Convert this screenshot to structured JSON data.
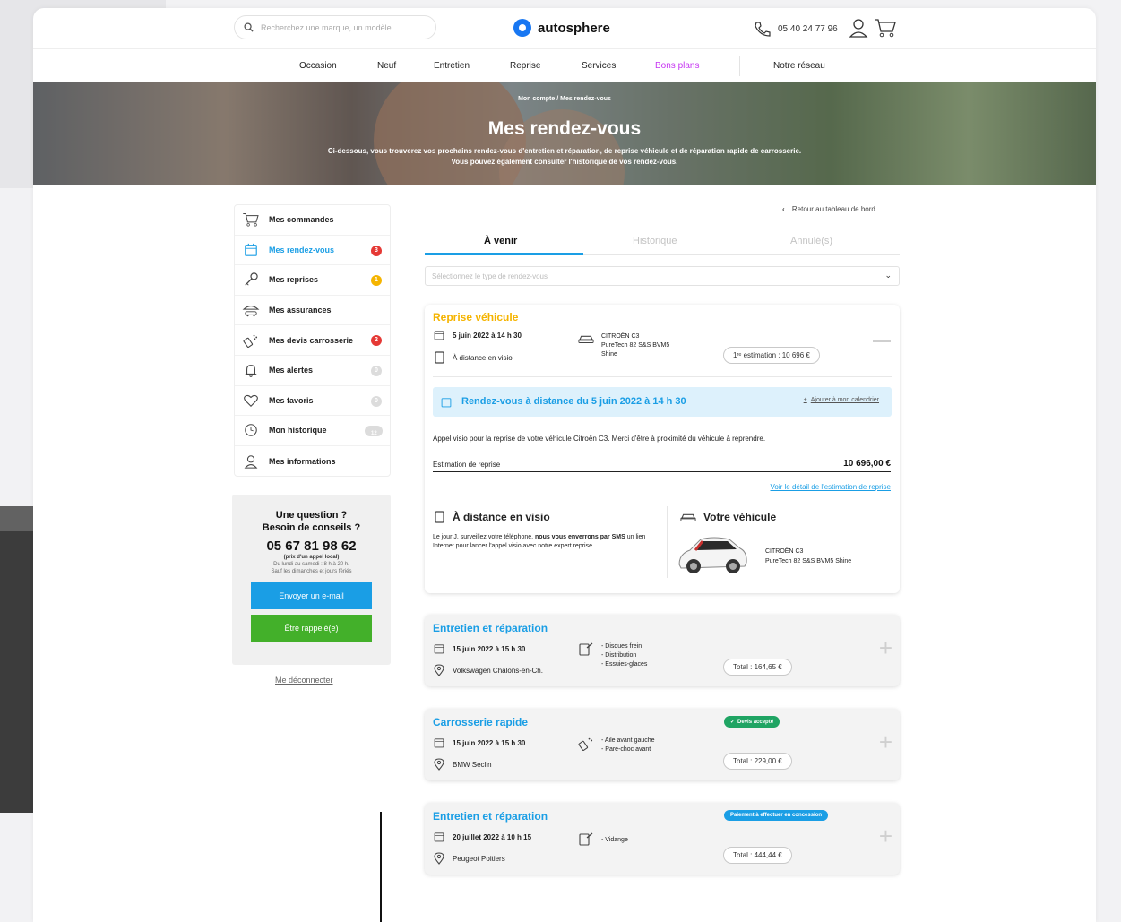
{
  "header": {
    "search_placeholder": "Recherchez une marque, un modèle...",
    "logo_text": "autosphere",
    "phone": "05 40 24 77 96"
  },
  "nav": {
    "items": [
      "Occasion",
      "Neuf",
      "Entretien",
      "Reprise",
      "Services",
      "Bons plans",
      "Notre réseau"
    ],
    "highlight_color": "#c634f2"
  },
  "hero": {
    "breadcrumb": "Mon compte / Mes rendez-vous",
    "title": "Mes rendez-vous",
    "desc_line1": "Ci-dessous, vous trouverez vos prochains rendez-vous d'entretien et réparation, de reprise véhicule et de réparation rapide de carrosserie.",
    "desc_line2": "Vous pouvez également consulter l'historique de vos rendez-vous."
  },
  "sidebar": {
    "items": [
      {
        "label": "Mes commandes",
        "icon": "cart-icon",
        "badge": ""
      },
      {
        "label": "Mes rendez-vous",
        "icon": "calendar-icon",
        "badge": "3",
        "badge_color": "#e53935"
      },
      {
        "label": "Mes reprises",
        "icon": "key-icon",
        "badge": "1",
        "badge_color": "#f5b400"
      },
      {
        "label": "Mes assurances",
        "icon": "car-umbrella-icon",
        "badge": ""
      },
      {
        "label": "Mes devis carrosserie",
        "icon": "spray-icon",
        "badge": "2",
        "badge_color": "#e53935"
      },
      {
        "label": "Mes alertes",
        "icon": "bell-icon",
        "badge": "0"
      },
      {
        "label": "Mes favoris",
        "icon": "heart-icon",
        "badge": "0"
      },
      {
        "label": "Mon historique",
        "icon": "history-icon",
        "badge": "12"
      },
      {
        "label": "Mes informations",
        "icon": "user-icon",
        "badge": ""
      }
    ],
    "active_color": "#1a9ee5"
  },
  "help": {
    "title_line1": "Une question ?",
    "title_line2": "Besoin de conseils ?",
    "phone": "05 67 81 98 62",
    "note": "(prix d'un appel local)",
    "hours1": "Du lundi au samedi : 8 h à 20 h.",
    "hours2": "Sauf les dimanches et jours fériés",
    "email_btn": "Envoyer un e-mail",
    "callback_btn": "Être rappelé(e)",
    "email_color": "#1a9ee5",
    "callback_color": "#43b02a"
  },
  "logout": "Me déconnecter",
  "back_link": "Retour au tableau de bord",
  "tabs": [
    "À venir",
    "Historique",
    "Annulé(s)"
  ],
  "select_placeholder": "Sélectionnez le type de rendez-vous",
  "reprise": {
    "title": "Reprise véhicule",
    "title_color": "#f5b400",
    "date": "5 juin 2022 à 14 h 30",
    "mode": "À distance en visio",
    "car_l1": "CITROËN C3",
    "car_l2": "PureTech 82 S&S BVM5",
    "car_l3": "Shine",
    "estimate": "1ʳᵉ estimation : 10 696 €",
    "banner": "Rendez-vous à distance du 5 juin 2022 à 14 h 30",
    "add_cal": "Ajouter à mon calendrier",
    "message": "Appel visio pour la reprise de votre véhicule Citroën C3. Merci d'être à proximité du véhicule à reprendre.",
    "est_label": "Estimation de reprise",
    "est_value": "10 696,00 €",
    "detail_link": "Voir le détail de l'estimation de reprise",
    "visio_title": "À distance en visio",
    "visio_text_1": "Le jour J, surveillez votre téléphone,",
    "visio_text_bold": "nous vous enverrons par SMS",
    "visio_text_2": "un lien Internet pour lancer l'appel visio avec notre expert reprise.",
    "vehicle_title": "Votre véhicule",
    "vehicle_l1": "CITROËN C3",
    "vehicle_l2": "PureTech 82 S&S BVM5 Shine"
  },
  "cards": [
    {
      "title": "Entretien et réparation",
      "date": "15 juin 2022 à 15 h 30",
      "place": "Volkswagen Châlons-en-Ch.",
      "services": [
        "- Disques frein",
        "- Distribution",
        "- Essuies-glaces"
      ],
      "total": "Total : 164,65 €",
      "badge": ""
    },
    {
      "title": "Carrosserie rapide",
      "date": "15 juin 2022 à 15 h 30",
      "place": "BMW Seclin",
      "services": [
        "- Aile avant gauche",
        "- Pare-choc avant"
      ],
      "total": "Total : 229,00 €",
      "badge": "Devis accepté",
      "badge_color": "#1fa463"
    },
    {
      "title": "Entretien et réparation",
      "date": "20 juillet 2022 à 10 h 15",
      "place": "Peugeot Poitiers",
      "services": [
        "- Vidange"
      ],
      "total": "Total : 444,44 €",
      "badge": "Paiement à effectuer en concession",
      "badge_color": "#1a9ee5"
    }
  ]
}
